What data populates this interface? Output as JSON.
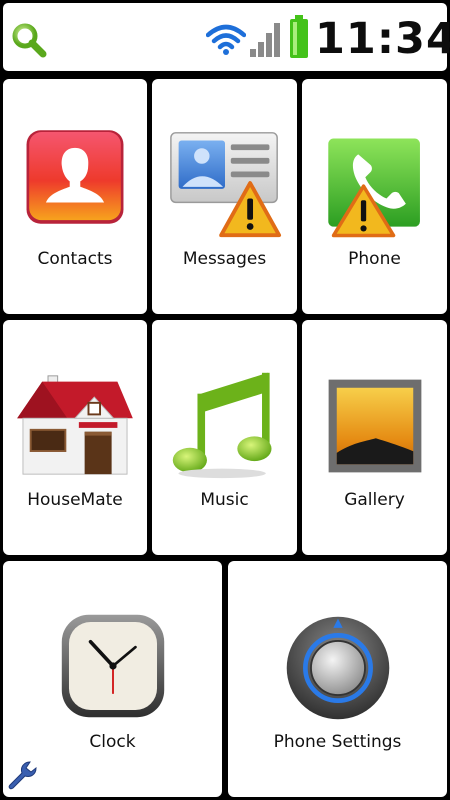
{
  "status_bar": {
    "time": "11:34",
    "icons": [
      "search-icon",
      "wifi-icon",
      "signal-icon",
      "battery-icon"
    ],
    "accent_color": "#1e6fd9",
    "battery_color": "#44c21a"
  },
  "tiles": [
    {
      "label": "Contacts",
      "icon": "contacts-icon",
      "warning": false
    },
    {
      "label": "Messages",
      "icon": "messages-icon",
      "warning": true
    },
    {
      "label": "Phone",
      "icon": "phone-icon",
      "warning": true
    },
    {
      "label": "HouseMate",
      "icon": "house-icon",
      "warning": false
    },
    {
      "label": "Music",
      "icon": "music-note-icon",
      "warning": false
    },
    {
      "label": "Gallery",
      "icon": "gallery-icon",
      "warning": false
    },
    {
      "label": "Clock",
      "icon": "clock-icon",
      "warning": false
    },
    {
      "label": "Phone Settings",
      "icon": "settings-knob-icon",
      "warning": false
    }
  ],
  "bottom_tool_icon": "wrench-icon"
}
